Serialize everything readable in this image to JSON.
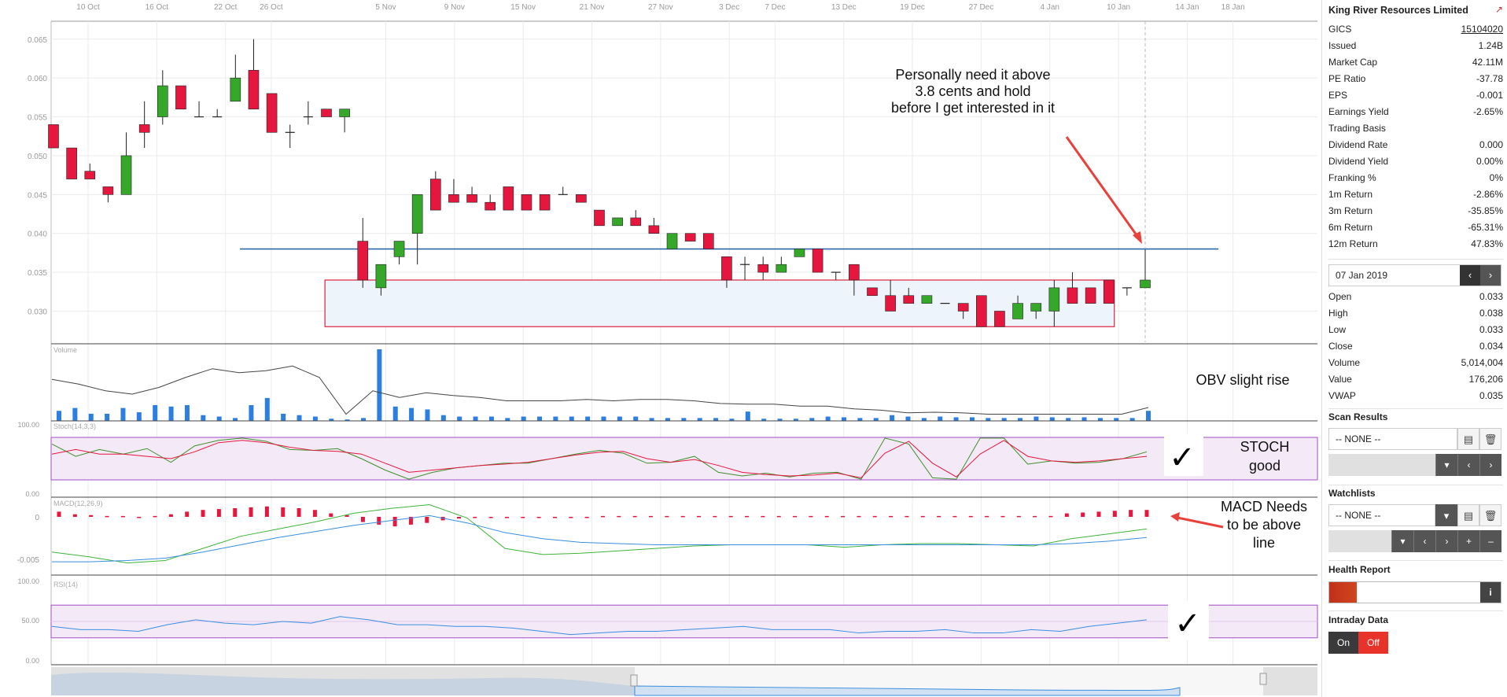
{
  "colors": {
    "up": "#35a82a",
    "down": "#e5173e",
    "grid": "#ececec",
    "volume": "#2c7fe0",
    "support_line": "#1f5fa8",
    "box_border": "#d9223e",
    "box_fill": "#eef4fb",
    "band": "#f3e9f7",
    "band_border": "#a14dc4",
    "arrow": "#e8413b"
  },
  "chart_data": {
    "type": "candlestick",
    "x_axis_labels": [
      "10 Oct",
      "16 Oct",
      "22 Oct",
      "26 Oct",
      "5 Nov",
      "9 Nov",
      "15 Nov",
      "21 Nov",
      "27 Nov",
      "3 Dec",
      "7 Dec",
      "13 Dec",
      "19 Dec",
      "27 Dec",
      "4 Jan",
      "10 Jan",
      "14 Jan",
      "18 Jan"
    ],
    "x_axis_label_index": [
      3,
      6,
      9,
      11,
      16,
      19,
      22,
      25,
      28,
      31,
      33,
      36,
      39,
      42,
      45,
      48,
      51,
      53
    ],
    "price_ticks": [
      "0.065",
      "0.060",
      "0.055",
      "0.050",
      "0.045",
      "0.040",
      "0.035",
      "0.030"
    ],
    "price_tick_values": [
      0.065,
      0.06,
      0.055,
      0.05,
      0.045,
      0.04,
      0.035,
      0.03
    ],
    "ylim": [
      0.026,
      0.067
    ],
    "candles": [
      {
        "o": 0.054,
        "h": 0.054,
        "l": 0.051,
        "c": 0.051
      },
      {
        "o": 0.051,
        "h": 0.051,
        "l": 0.047,
        "c": 0.047
      },
      {
        "o": 0.048,
        "h": 0.049,
        "l": 0.047,
        "c": 0.047
      },
      {
        "o": 0.046,
        "h": 0.046,
        "l": 0.044,
        "c": 0.045
      },
      {
        "o": 0.045,
        "h": 0.053,
        "l": 0.045,
        "c": 0.05
      },
      {
        "o": 0.054,
        "h": 0.057,
        "l": 0.051,
        "c": 0.053
      },
      {
        "o": 0.055,
        "h": 0.061,
        "l": 0.054,
        "c": 0.059
      },
      {
        "o": 0.059,
        "h": 0.059,
        "l": 0.056,
        "c": 0.056
      },
      {
        "o": 0.055,
        "h": 0.057,
        "l": 0.055,
        "c": 0.055
      },
      {
        "o": 0.055,
        "h": 0.056,
        "l": 0.055,
        "c": 0.055
      },
      {
        "o": 0.057,
        "h": 0.063,
        "l": 0.057,
        "c": 0.06
      },
      {
        "o": 0.061,
        "h": 0.065,
        "l": 0.056,
        "c": 0.056
      },
      {
        "o": 0.058,
        "h": 0.058,
        "l": 0.053,
        "c": 0.053
      },
      {
        "o": 0.053,
        "h": 0.054,
        "l": 0.051,
        "c": 0.053
      },
      {
        "o": 0.055,
        "h": 0.057,
        "l": 0.054,
        "c": 0.055
      },
      {
        "o": 0.056,
        "h": 0.056,
        "l": 0.055,
        "c": 0.055
      },
      {
        "o": 0.055,
        "h": 0.056,
        "l": 0.053,
        "c": 0.056
      },
      {
        "o": 0.039,
        "h": 0.042,
        "l": 0.033,
        "c": 0.034
      },
      {
        "o": 0.033,
        "h": 0.036,
        "l": 0.032,
        "c": 0.036
      },
      {
        "o": 0.037,
        "h": 0.039,
        "l": 0.036,
        "c": 0.039
      },
      {
        "o": 0.04,
        "h": 0.045,
        "l": 0.036,
        "c": 0.045
      },
      {
        "o": 0.047,
        "h": 0.048,
        "l": 0.043,
        "c": 0.043
      },
      {
        "o": 0.045,
        "h": 0.047,
        "l": 0.044,
        "c": 0.044
      },
      {
        "o": 0.045,
        "h": 0.046,
        "l": 0.044,
        "c": 0.044
      },
      {
        "o": 0.044,
        "h": 0.045,
        "l": 0.043,
        "c": 0.043
      },
      {
        "o": 0.046,
        "h": 0.046,
        "l": 0.043,
        "c": 0.043
      },
      {
        "o": 0.045,
        "h": 0.045,
        "l": 0.043,
        "c": 0.043
      },
      {
        "o": 0.045,
        "h": 0.045,
        "l": 0.043,
        "c": 0.043
      },
      {
        "o": 0.045,
        "h": 0.046,
        "l": 0.045,
        "c": 0.045
      },
      {
        "o": 0.045,
        "h": 0.045,
        "l": 0.044,
        "c": 0.044
      },
      {
        "o": 0.043,
        "h": 0.043,
        "l": 0.041,
        "c": 0.041
      },
      {
        "o": 0.041,
        "h": 0.042,
        "l": 0.041,
        "c": 0.042
      },
      {
        "o": 0.042,
        "h": 0.043,
        "l": 0.041,
        "c": 0.041
      },
      {
        "o": 0.041,
        "h": 0.042,
        "l": 0.04,
        "c": 0.04
      },
      {
        "o": 0.038,
        "h": 0.04,
        "l": 0.038,
        "c": 0.04
      },
      {
        "o": 0.04,
        "h": 0.04,
        "l": 0.039,
        "c": 0.039
      },
      {
        "o": 0.04,
        "h": 0.04,
        "l": 0.038,
        "c": 0.038
      },
      {
        "o": 0.037,
        "h": 0.037,
        "l": 0.033,
        "c": 0.034
      },
      {
        "o": 0.036,
        "h": 0.037,
        "l": 0.034,
        "c": 0.036
      },
      {
        "o": 0.036,
        "h": 0.037,
        "l": 0.034,
        "c": 0.035
      },
      {
        "o": 0.035,
        "h": 0.037,
        "l": 0.035,
        "c": 0.036
      },
      {
        "o": 0.037,
        "h": 0.038,
        "l": 0.037,
        "c": 0.038
      },
      {
        "o": 0.038,
        "h": 0.038,
        "l": 0.035,
        "c": 0.035
      },
      {
        "o": 0.035,
        "h": 0.035,
        "l": 0.034,
        "c": 0.035
      },
      {
        "o": 0.036,
        "h": 0.036,
        "l": 0.032,
        "c": 0.034
      },
      {
        "o": 0.033,
        "h": 0.033,
        "l": 0.032,
        "c": 0.032
      },
      {
        "o": 0.032,
        "h": 0.034,
        "l": 0.03,
        "c": 0.03
      },
      {
        "o": 0.032,
        "h": 0.033,
        "l": 0.031,
        "c": 0.031
      },
      {
        "o": 0.031,
        "h": 0.032,
        "l": 0.031,
        "c": 0.032
      },
      {
        "o": 0.031,
        "h": 0.031,
        "l": 0.031,
        "c": 0.031
      },
      {
        "o": 0.031,
        "h": 0.031,
        "l": 0.029,
        "c": 0.03
      },
      {
        "o": 0.032,
        "h": 0.032,
        "l": 0.028,
        "c": 0.028
      },
      {
        "o": 0.03,
        "h": 0.03,
        "l": 0.028,
        "c": 0.028
      },
      {
        "o": 0.029,
        "h": 0.032,
        "l": 0.029,
        "c": 0.031
      },
      {
        "o": 0.03,
        "h": 0.031,
        "l": 0.029,
        "c": 0.031
      },
      {
        "o": 0.03,
        "h": 0.034,
        "l": 0.028,
        "c": 0.033
      },
      {
        "o": 0.033,
        "h": 0.035,
        "l": 0.031,
        "c": 0.031
      },
      {
        "o": 0.033,
        "h": 0.033,
        "l": 0.031,
        "c": 0.031
      },
      {
        "o": 0.034,
        "h": 0.034,
        "l": 0.031,
        "c": 0.031
      },
      {
        "o": 0.033,
        "h": 0.033,
        "l": 0.032,
        "c": 0.033
      },
      {
        "o": 0.033,
        "h": 0.038,
        "l": 0.033,
        "c": 0.034
      }
    ],
    "support_level": 0.038,
    "box": {
      "from_index": 16,
      "to_index": 58,
      "low": 0.028,
      "high": 0.034
    },
    "volume": {
      "label": "Volume",
      "bars": [
        0.14,
        0.18,
        0.1,
        0.1,
        0.18,
        0.12,
        0.22,
        0.2,
        0.22,
        0.08,
        0.06,
        0.04,
        0.22,
        0.32,
        0.1,
        0.08,
        0.06,
        0.03,
        0.02,
        0.04,
        1.0,
        0.2,
        0.18,
        0.16,
        0.08,
        0.06,
        0.06,
        0.06,
        0.04,
        0.06,
        0.06,
        0.06,
        0.06,
        0.06,
        0.06,
        0.06,
        0.06,
        0.04,
        0.04,
        0.04,
        0.04,
        0.04,
        0.03,
        0.13,
        0.03,
        0.03,
        0.03,
        0.04,
        0.06,
        0.05,
        0.04,
        0.04,
        0.08,
        0.06,
        0.04,
        0.06,
        0.05,
        0.05,
        0.04,
        0.04,
        0.04,
        0.06,
        0.05,
        0.04,
        0.05,
        0.04,
        0.04,
        0.04,
        0.14
      ],
      "obv": [
        0.62,
        0.55,
        0.45,
        0.4,
        0.5,
        0.65,
        0.78,
        0.72,
        0.75,
        0.82,
        0.65,
        0.1,
        0.45,
        0.35,
        0.42,
        0.38,
        0.35,
        0.3,
        0.3,
        0.3,
        0.32,
        0.3,
        0.32,
        0.32,
        0.3,
        0.26,
        0.25,
        0.25,
        0.22,
        0.22,
        0.18,
        0.16,
        0.12,
        0.13,
        0.12,
        0.1,
        0.1,
        0.1,
        0.1,
        0.1,
        0.1,
        0.2
      ]
    },
    "stoch": {
      "label": "Stoch(14,3,3)",
      "ticks": [
        "100.00",
        "0.00"
      ],
      "k": [
        0.82,
        0.55,
        0.7,
        0.6,
        0.72,
        0.42,
        0.78,
        0.9,
        0.95,
        0.88,
        0.7,
        0.68,
        0.72,
        0.5,
        0.25,
        0.05,
        0.2,
        0.3,
        0.35,
        0.4,
        0.4,
        0.5,
        0.6,
        0.68,
        0.62,
        0.4,
        0.42,
        0.55,
        0.2,
        0.12,
        0.18,
        0.1,
        0.18,
        0.2,
        0.05,
        0.95,
        0.82,
        0.08,
        0.05,
        0.95,
        0.95,
        0.38,
        0.45,
        0.4,
        0.42,
        0.5,
        0.65
      ],
      "d": [
        0.6,
        0.7,
        0.6,
        0.6,
        0.55,
        0.5,
        0.65,
        0.85,
        0.9,
        0.85,
        0.75,
        0.68,
        0.66,
        0.6,
        0.4,
        0.2,
        0.25,
        0.3,
        0.35,
        0.38,
        0.42,
        0.5,
        0.58,
        0.64,
        0.66,
        0.5,
        0.42,
        0.48,
        0.35,
        0.2,
        0.15,
        0.12,
        0.14,
        0.18,
        0.08,
        0.62,
        0.88,
        0.4,
        0.1,
        0.6,
        0.9,
        0.55,
        0.45,
        0.42,
        0.45,
        0.5,
        0.55
      ]
    },
    "macd": {
      "label": "MACD(12,26,9)",
      "ticks": [
        "0",
        "-0.005"
      ],
      "hist": [
        0.3,
        0.15,
        0.1,
        0.05,
        0.05,
        0.0,
        0.05,
        0.15,
        0.3,
        0.4,
        0.45,
        0.5,
        0.55,
        0.6,
        0.55,
        0.5,
        0.4,
        0.2,
        0.1,
        -0.3,
        -0.45,
        -0.55,
        -0.45,
        -0.35,
        -0.2,
        -0.1,
        -0.05,
        0.0,
        0.0,
        0.0,
        0.0,
        0.0,
        0.0,
        0.0,
        0.05,
        0.05,
        0.05,
        0.05,
        0.05,
        0.05,
        0.05,
        0.05,
        0.05,
        0.05,
        0.05,
        0.05,
        0.05,
        0.05,
        0.05,
        0.05,
        0.05,
        0.05,
        0.05,
        0.05,
        0.05,
        0.05,
        0.05,
        0.05,
        0.05,
        0.05,
        0.05,
        0.05,
        0.05,
        0.2,
        0.25,
        0.3,
        0.35,
        0.4,
        0.4
      ],
      "macd_line": [
        -0.0028,
        -0.0032,
        -0.0037,
        -0.0035,
        -0.0025,
        -0.0015,
        -0.0009,
        -0.0003,
        0.0004,
        0.0008,
        0.0011,
        0.0,
        -0.0025,
        -0.003,
        -0.0029,
        -0.0027,
        -0.0025,
        -0.0023,
        -0.0022,
        -0.0022,
        -0.0022,
        -0.0024,
        -0.0022,
        -0.0021,
        -0.0021,
        -0.0022,
        -0.0023,
        -0.0017,
        -0.0013,
        -0.0009
      ],
      "signal_line": [
        -0.0036,
        -0.0036,
        -0.0035,
        -0.0033,
        -0.0028,
        -0.0022,
        -0.0016,
        -0.0011,
        -0.0006,
        -0.0002,
        0.0002,
        -0.0004,
        -0.0012,
        -0.0017,
        -0.002,
        -0.0021,
        -0.0022,
        -0.0022,
        -0.0022,
        -0.0022,
        -0.0022,
        -0.0022,
        -0.0022,
        -0.0022,
        -0.0022,
        -0.0022,
        -0.0022,
        -0.0021,
        -0.0019,
        -0.0016
      ],
      "ylim": [
        -0.0045,
        0.0012
      ]
    },
    "rsi": {
      "label": "RSI(14)",
      "ticks": [
        "100.00",
        "50.00",
        "0.00"
      ],
      "values": [
        44,
        40,
        40,
        38,
        46,
        52,
        48,
        46,
        50,
        48,
        56,
        52,
        46,
        46,
        44,
        44,
        42,
        38,
        34,
        36,
        38,
        38,
        40,
        42,
        44,
        40,
        40,
        40,
        36,
        38,
        38,
        40,
        36,
        36,
        40,
        38,
        44,
        48,
        52
      ],
      "band": [
        30,
        70
      ]
    }
  },
  "annotations": {
    "price_note": "Personally need it above\n3.8 cents and hold\nbefore I get interested in it",
    "obv_note": "OBV slight rise",
    "stoch_note": "STOCH\ngood",
    "macd_note": "MACD Needs\nto be above\nline",
    "check_mark": "✓"
  },
  "sidebar": {
    "company": "King River Resources Limited",
    "stats": [
      {
        "label": "GICS",
        "value": "15104020"
      },
      {
        "label": "Issued",
        "value": "1.24B"
      },
      {
        "label": "Market Cap",
        "value": "42.11M"
      },
      {
        "label": "PE Ratio",
        "value": "-37.78"
      },
      {
        "label": "EPS",
        "value": "-0.001"
      },
      {
        "label": "Earnings Yield",
        "value": "-2.65%"
      },
      {
        "label": "Trading Basis",
        "value": ""
      },
      {
        "label": "Dividend Rate",
        "value": "0.000"
      },
      {
        "label": "Dividend Yield",
        "value": "0.00%"
      },
      {
        "label": "Franking %",
        "value": "0%"
      },
      {
        "label": "1m Return",
        "value": "-2.86%"
      },
      {
        "label": "3m Return",
        "value": "-35.85%"
      },
      {
        "label": "6m Return",
        "value": "-65.31%"
      },
      {
        "label": "12m Return",
        "value": "47.83%"
      }
    ],
    "date": "07 Jan 2019",
    "ohlc": [
      {
        "label": "Open",
        "value": "0.033"
      },
      {
        "label": "High",
        "value": "0.038"
      },
      {
        "label": "Low",
        "value": "0.033"
      },
      {
        "label": "Close",
        "value": "0.034"
      },
      {
        "label": "Volume",
        "value": "5,014,004"
      },
      {
        "label": "Value",
        "value": "176,206"
      },
      {
        "label": "VWAP",
        "value": "0.035"
      }
    ],
    "scan_title": "Scan Results",
    "scan_select": "-- NONE --",
    "watch_title": "Watchlists",
    "watch_select": "-- NONE --",
    "health_title": "Health Report",
    "health_level": 0.16,
    "intraday_title": "Intraday Data",
    "on_label": "On",
    "off_label": "Off"
  },
  "icons": {
    "external": "external-link-icon",
    "prev": "chevron-left-icon",
    "next": "chevron-right-icon",
    "doc": "document-icon",
    "trash": "trash-icon",
    "caret": "caret-down-icon",
    "plus": "plus-icon",
    "minus": "minus-icon",
    "info": "info-icon"
  }
}
